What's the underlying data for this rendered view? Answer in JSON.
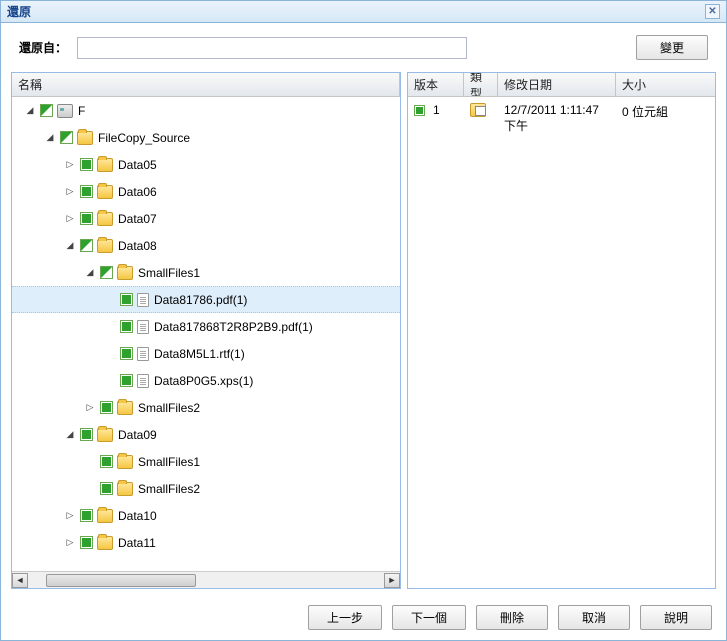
{
  "dialog": {
    "title": "還原"
  },
  "topbar": {
    "label": "還原自：",
    "value": "",
    "change_btn": "變更"
  },
  "tree": {
    "header": "名稱",
    "nodes": [
      {
        "depth": 0,
        "exp": "open",
        "chk": "partial",
        "ico": "drive",
        "label": "F"
      },
      {
        "depth": 1,
        "exp": "open",
        "chk": "partial",
        "ico": "folder",
        "label": "FileCopy_Source"
      },
      {
        "depth": 2,
        "exp": "closed",
        "chk": "full",
        "ico": "folder",
        "label": "Data05"
      },
      {
        "depth": 2,
        "exp": "closed",
        "chk": "full",
        "ico": "folder",
        "label": "Data06"
      },
      {
        "depth": 2,
        "exp": "closed",
        "chk": "full",
        "ico": "folder",
        "label": "Data07"
      },
      {
        "depth": 2,
        "exp": "open",
        "chk": "partial",
        "ico": "folder",
        "label": "Data08"
      },
      {
        "depth": 3,
        "exp": "open",
        "chk": "partial",
        "ico": "folder",
        "label": "SmallFiles1"
      },
      {
        "depth": 4,
        "exp": "none",
        "chk": "full",
        "ico": "file",
        "label": "Data81786.pdf(1)",
        "selected": true
      },
      {
        "depth": 4,
        "exp": "none",
        "chk": "full",
        "ico": "file",
        "label": "Data817868T2R8P2B9.pdf(1)"
      },
      {
        "depth": 4,
        "exp": "none",
        "chk": "full",
        "ico": "file",
        "label": "Data8M5L1.rtf(1)"
      },
      {
        "depth": 4,
        "exp": "none",
        "chk": "full",
        "ico": "file",
        "label": "Data8P0G5.xps(1)"
      },
      {
        "depth": 3,
        "exp": "closed",
        "chk": "full",
        "ico": "folder",
        "label": "SmallFiles2"
      },
      {
        "depth": 2,
        "exp": "open",
        "chk": "full",
        "ico": "folder",
        "label": "Data09"
      },
      {
        "depth": 3,
        "exp": "none",
        "chk": "full",
        "ico": "folder",
        "label": "SmallFiles1"
      },
      {
        "depth": 3,
        "exp": "none",
        "chk": "full",
        "ico": "folder",
        "label": "SmallFiles2"
      },
      {
        "depth": 2,
        "exp": "closed",
        "chk": "full",
        "ico": "folder",
        "label": "Data10"
      },
      {
        "depth": 2,
        "exp": "closed",
        "chk": "full",
        "ico": "folder",
        "label": "Data11"
      }
    ]
  },
  "grid": {
    "headers": {
      "version": "版本",
      "type": "類型",
      "modified": "修改日期",
      "size": "大小"
    },
    "widths": {
      "version": 56,
      "type": 34,
      "modified": 118,
      "size": 80
    },
    "rows": [
      {
        "version": "1",
        "type_icon": "folder-copy",
        "modified": "12/7/2011 1:11:47 下午",
        "size": "0 位元組"
      }
    ]
  },
  "footer": {
    "prev": "上一步",
    "next": "下一個",
    "delete": "刪除",
    "cancel": "取消",
    "help": "說明"
  }
}
